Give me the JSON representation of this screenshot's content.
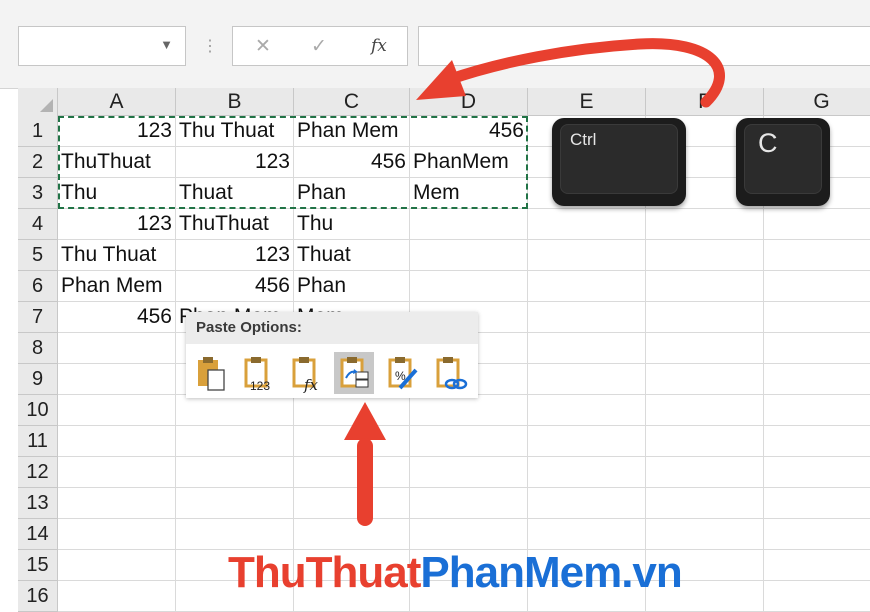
{
  "formula_bar": {
    "name_box_value": "",
    "cancel_glyph": "✕",
    "enter_glyph": "✓",
    "fx_label": "fx",
    "formula_value": ""
  },
  "columns": [
    "A",
    "B",
    "C",
    "D",
    "E",
    "F",
    "G"
  ],
  "rows": [
    "1",
    "2",
    "3",
    "4",
    "5",
    "6",
    "7",
    "8",
    "9",
    "10",
    "11",
    "12",
    "13",
    "14",
    "15",
    "16"
  ],
  "cells": {
    "r1": [
      "123",
      "Thu Thuat",
      "Phan Mem",
      "456"
    ],
    "r2": [
      "ThuThuat",
      "123",
      "456",
      "PhanMem"
    ],
    "r3": [
      "Thu",
      "Thuat",
      "Phan",
      "Mem"
    ],
    "r4": [
      "123",
      "ThuThuat",
      "Thu",
      ""
    ],
    "r5": [
      "Thu Thuat",
      "123",
      "Thuat",
      ""
    ],
    "r6": [
      "Phan Mem",
      "456",
      "Phan",
      ""
    ],
    "r7": [
      "456",
      "Phan Mem",
      "Mem",
      ""
    ]
  },
  "keys": {
    "ctrl": "Ctrl",
    "c": "C"
  },
  "paste_options": {
    "title": "Paste Options:",
    "values_badge": "123",
    "formulas_badge": "fx",
    "formatting_badge": "%",
    "icons": [
      "paste-icon",
      "paste-values-icon",
      "paste-formulas-icon",
      "paste-transpose-icon",
      "paste-formatting-icon",
      "paste-link-icon"
    ],
    "active_index": 3
  },
  "watermark": {
    "part1": "ThuThuat",
    "part2": "PhanMem.vn"
  },
  "colors": {
    "arrow": "#e8402f",
    "copy_border": "#217346",
    "watermark_red": "#e8402f",
    "watermark_blue": "#1a6fd6"
  }
}
